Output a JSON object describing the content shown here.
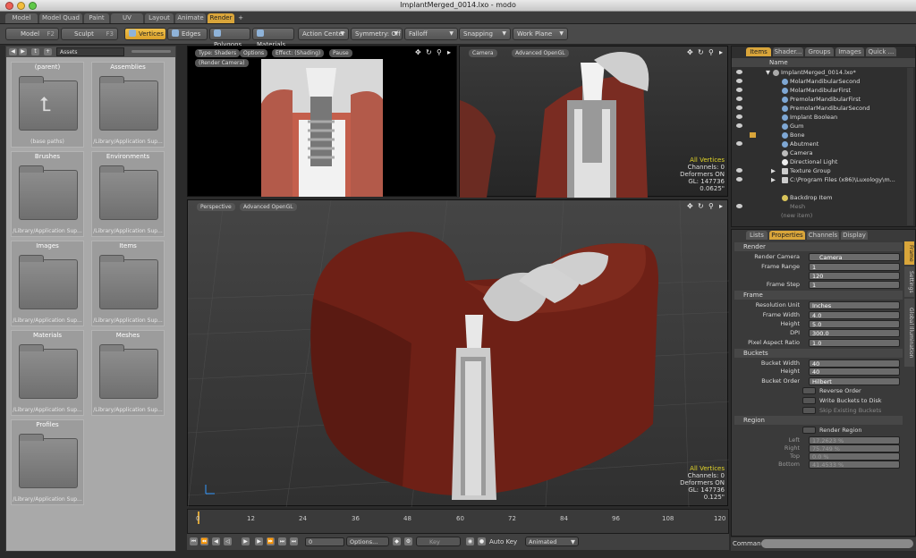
{
  "window": {
    "title": "ImplantMerged_0014.lxo - modo"
  },
  "layout_tabs": [
    "Model",
    "Model Quad",
    "Paint",
    "UV",
    "Layout",
    "Animate",
    "Render",
    "+"
  ],
  "active_layout_tab": "Render",
  "toolbar": {
    "model": {
      "label": "Model",
      "key": "F2"
    },
    "sculpt": {
      "label": "Sculpt",
      "key": "F3"
    },
    "vertices": "Vertices",
    "edges": "Edges",
    "polygons": "Polygons",
    "materials": "Materials",
    "action_center": "Action Center",
    "symmetry": "Symmetry: Off",
    "falloff": "Falloff",
    "snapping": "Snapping",
    "work_plane": "Work Plane"
  },
  "assets": {
    "dropdown": "Assets",
    "cells": [
      {
        "name": "(parent)",
        "path": "(base paths)"
      },
      {
        "name": "Assemblies",
        "path": "/Library/Application Sup..."
      },
      {
        "name": "Brushes",
        "path": "/Library/Application Sup..."
      },
      {
        "name": "Environments",
        "path": "/Library/Application Sup..."
      },
      {
        "name": "Images",
        "path": "/Library/Application Sup..."
      },
      {
        "name": "Items",
        "path": "/Library/Application Sup..."
      },
      {
        "name": "Materials",
        "path": "/Library/Application Sup..."
      },
      {
        "name": "Meshes",
        "path": "/Library/Application Sup..."
      },
      {
        "name": "Profiles",
        "path": "/Library/Application Sup..."
      }
    ]
  },
  "viewport_top_left": {
    "type": "Type: Shaders",
    "options": "Options",
    "effect": "Effect: (Shading)",
    "pause": "Pause",
    "camera": "(Render Camera)"
  },
  "viewport_top_right": {
    "view": "Camera",
    "renderer": "Advanced OpenGL",
    "stats": {
      "mode": "All Vertices",
      "channels": "Channels: 0",
      "deformers": "Deformers ON",
      "gl": "GL: 147736",
      "scale": "0.0625\""
    }
  },
  "viewport_main": {
    "view": "Perspective",
    "renderer": "Advanced OpenGL",
    "stats": {
      "mode": "All Vertices",
      "channels": "Channels: 0",
      "deformers": "Deformers ON",
      "gl": "GL: 147736",
      "scale": "0.125\""
    }
  },
  "items_panel": {
    "tabs": [
      "Items",
      "Shader...",
      "Groups",
      "Images",
      "Quick ..."
    ],
    "active_tab": "Items",
    "column": "Name",
    "items": [
      "ImplantMerged_0014.lxo*",
      "MolarMandibularSecond",
      "MolarMandibularFirst",
      "PremolarMandibularFirst",
      "PremolarMandibularSecond",
      "Implant Boolean",
      "Gum",
      "Bone",
      "Abutment",
      "Camera",
      "Directional Light",
      "Texture Group",
      "C:\\Program Files (x86)\\Luxology\\m...",
      "Backdrop Item",
      "Mesh",
      "(new item)"
    ]
  },
  "properties_panel": {
    "tabs": [
      "Lists",
      "Properties",
      "Channels",
      "Display"
    ],
    "active_tab": "Properties",
    "side_tabs": [
      "Frame",
      "Settings",
      "Global Illumination"
    ],
    "render_section": "Render",
    "render_camera": {
      "label": "Render Camera",
      "value": "Camera"
    },
    "frame_range": {
      "label": "Frame Range",
      "start": "1",
      "end": "120"
    },
    "frame_step": {
      "label": "Frame Step",
      "value": "1"
    },
    "frame_section": "Frame",
    "resolution_unit": {
      "label": "Resolution Unit",
      "value": "Inches"
    },
    "frame_width": {
      "label": "Frame Width",
      "value": "4.0"
    },
    "frame_height": {
      "label": "Height",
      "value": "5.0"
    },
    "dpi": {
      "label": "DPI",
      "value": "300.0"
    },
    "pixel_aspect": {
      "label": "Pixel Aspect Ratio",
      "value": "1.0"
    },
    "buckets_section": "Buckets",
    "bucket_width": {
      "label": "Bucket Width",
      "value": "40"
    },
    "bucket_height": {
      "label": "Height",
      "value": "40"
    },
    "bucket_order": {
      "label": "Bucket Order",
      "value": "Hilbert"
    },
    "reverse_order": "Reverse Order",
    "write_buckets": "Write Buckets to Disk",
    "skip_buckets": "Skip Existing Buckets",
    "region_section": "Region",
    "render_region": "Render Region",
    "left": {
      "label": "Left",
      "value": "17.2623 %"
    },
    "right": {
      "label": "Right",
      "value": "75.749 %"
    },
    "top": {
      "label": "Top",
      "value": "0.0 %"
    },
    "bottom": {
      "label": "Bottom",
      "value": "41.4533 %"
    }
  },
  "timeline": {
    "ticks": [
      "0",
      "12",
      "24",
      "36",
      "48",
      "60",
      "72",
      "84",
      "96",
      "108",
      "120"
    ],
    "current_frame": "0"
  },
  "transport": {
    "frame": "0",
    "options": "Options...",
    "key": "Key",
    "auto_key": "Auto Key",
    "mode": "Animated"
  },
  "command": {
    "label": "Command"
  }
}
